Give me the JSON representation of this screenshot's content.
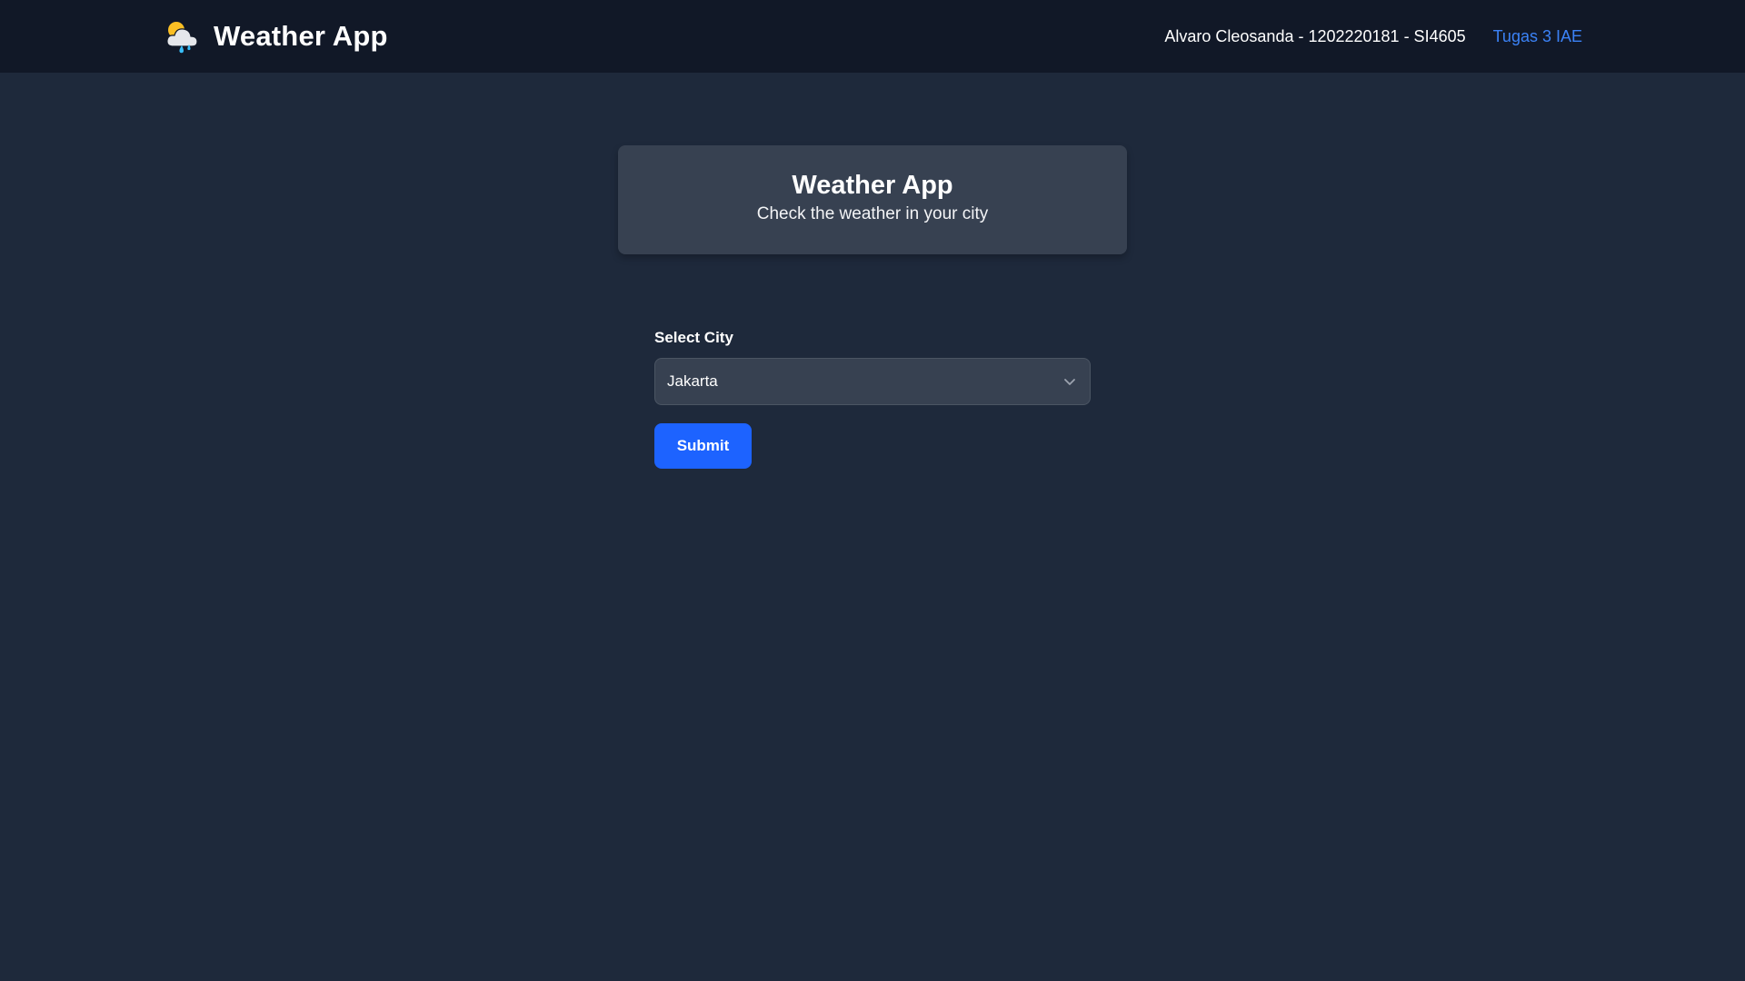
{
  "navbar": {
    "brand_icon": "weather-cloud-sun-rain-icon",
    "title": "Weather App",
    "user_info": "Alvaro Cleosanda - 1202220181 - SI4605",
    "link_label": "Tugas 3 IAE"
  },
  "hero": {
    "title": "Weather App",
    "subtitle": "Check the weather in your city"
  },
  "form": {
    "city_label": "Select City",
    "city_selected": "Jakarta",
    "submit_label": "Submit"
  },
  "colors": {
    "page_background": "#1e293b",
    "navbar_background": "#111827",
    "card_background": "#374151",
    "link": "#3b82f6",
    "button": "#1d63ff"
  }
}
